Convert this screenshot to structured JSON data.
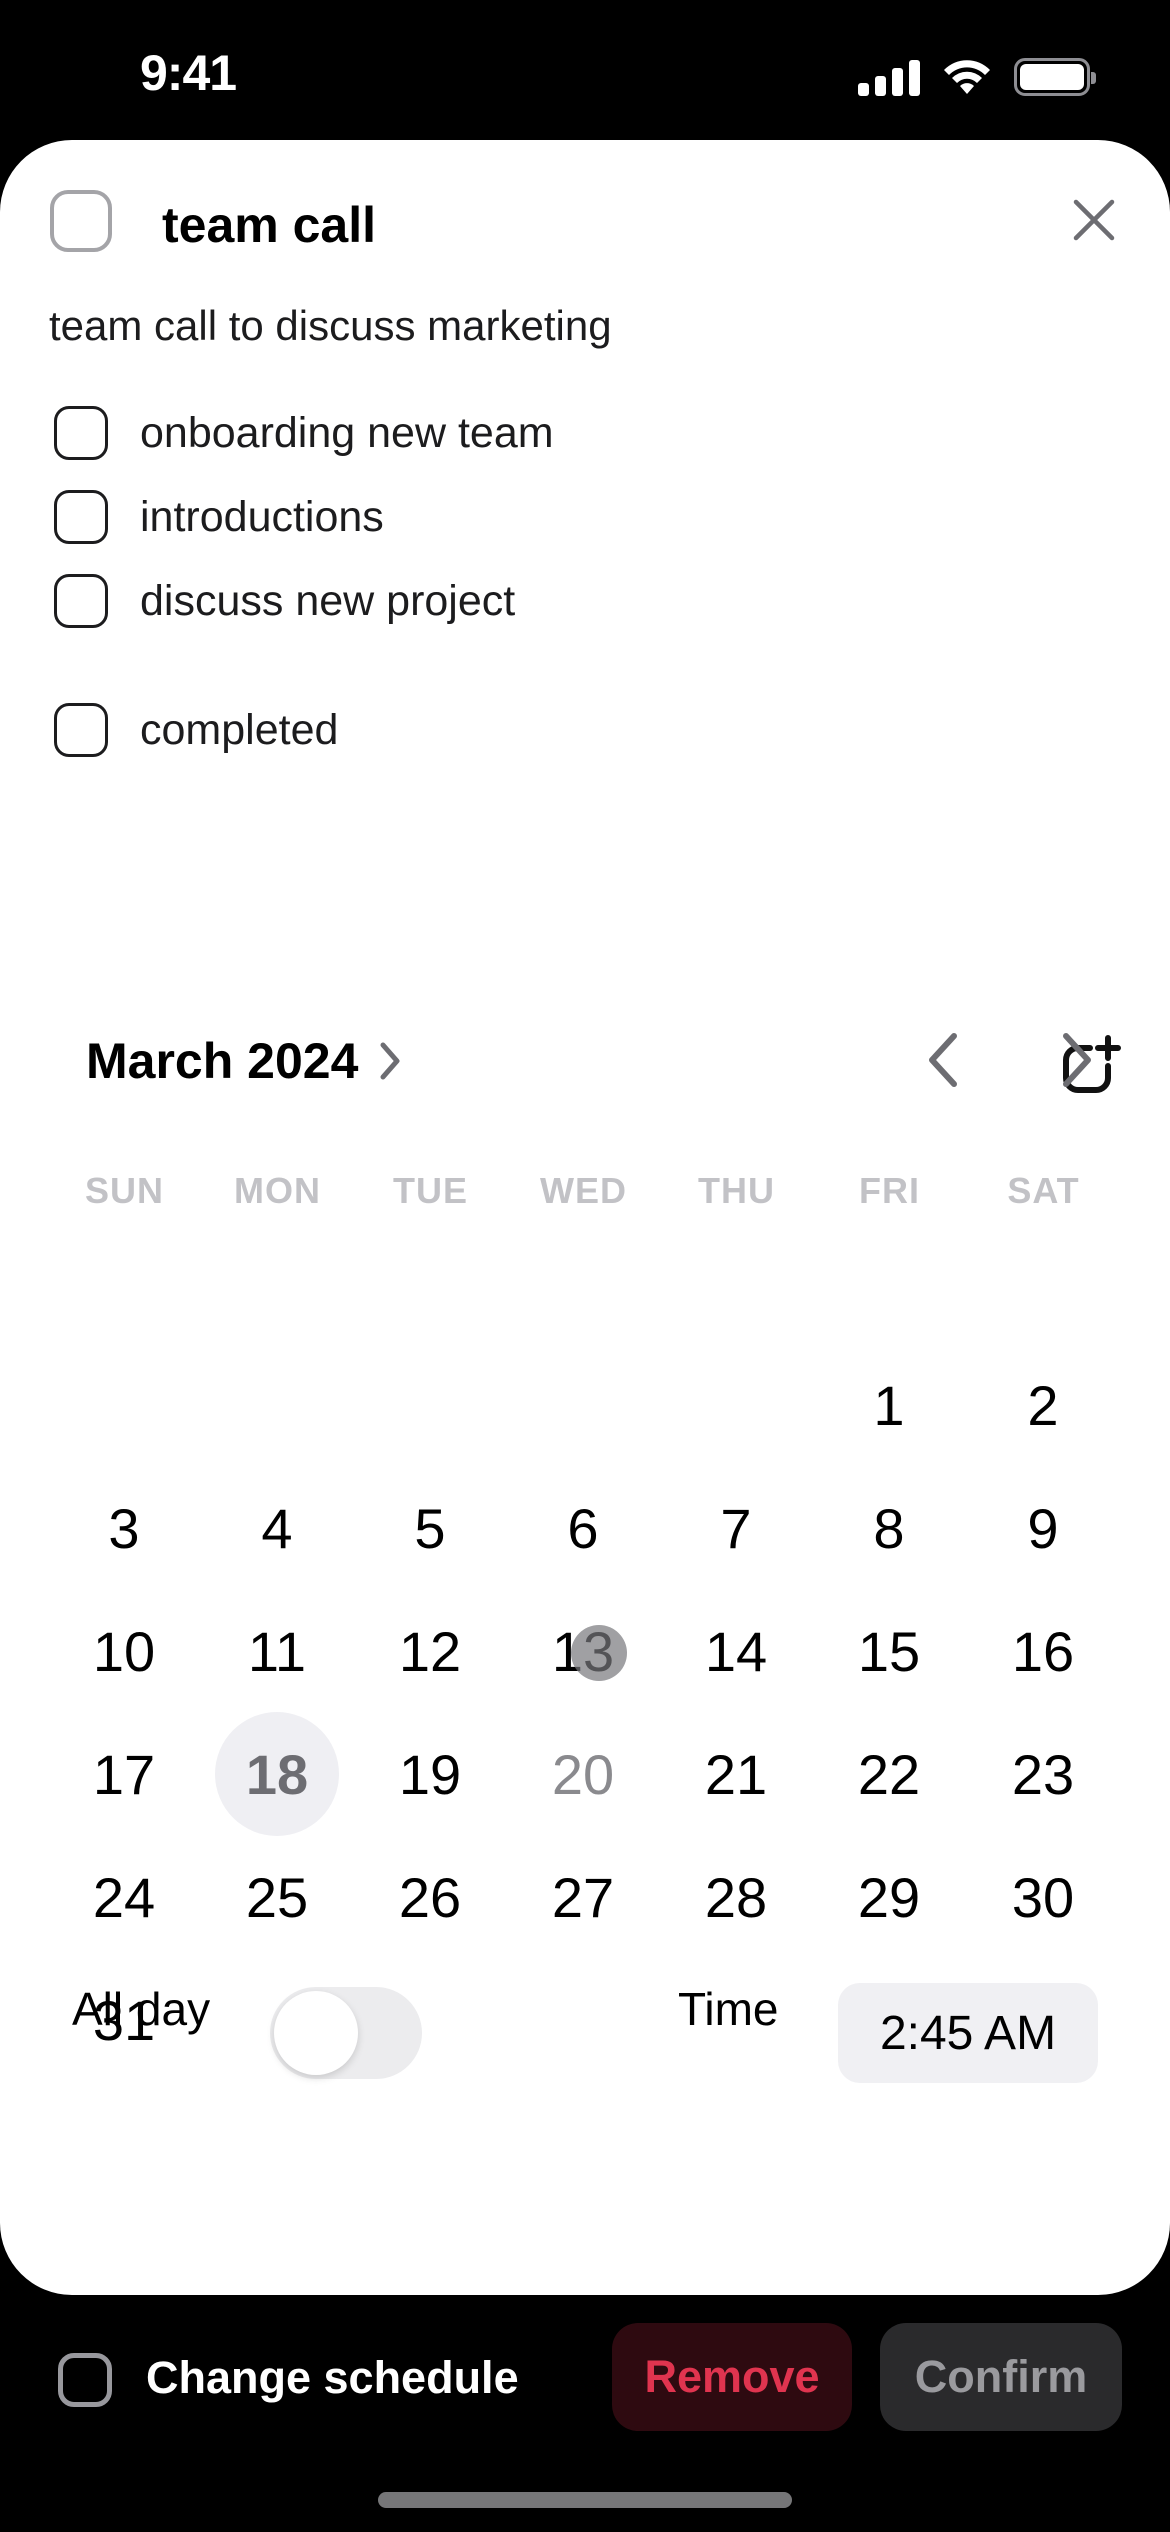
{
  "status_bar": {
    "time": "9:41",
    "icons": [
      "cellular-signal-icon",
      "wifi-icon",
      "battery-icon"
    ]
  },
  "task": {
    "title": "team call",
    "completed": false,
    "description": "team call to discuss marketing",
    "close_icon": "close-icon",
    "subtasks": [
      {
        "label": "onboarding new team",
        "checked": false
      },
      {
        "label": "introductions",
        "checked": false
      },
      {
        "label": "discuss new project",
        "checked": false
      }
    ],
    "completed_item": {
      "label": "completed",
      "checked": false
    },
    "add_subtask_icon": "add-item-icon"
  },
  "calendar": {
    "month_label": "March 2024",
    "month_chevron_icon": "chevron-right-icon",
    "prev_icon": "chevron-left-icon",
    "next_icon": "chevron-right-icon",
    "weekdays": [
      "SUN",
      "MON",
      "TUE",
      "WED",
      "THU",
      "FRI",
      "SAT"
    ],
    "first_weekday_index": 5,
    "days_in_month": 31,
    "selected_day": 18,
    "muted_days": [
      20
    ],
    "touch_indicator_day": 13,
    "accent_colors": {
      "selected_bg": "#efeff3",
      "selected_text": "#6d6d72"
    }
  },
  "schedule": {
    "all_day_label": "All day",
    "all_day_on": false,
    "time_label": "Time",
    "time_value": "2:45 AM"
  },
  "footer": {
    "change_schedule_label": "Change schedule",
    "change_schedule_checked": false,
    "remove_label": "Remove",
    "confirm_label": "Confirm",
    "colors": {
      "remove_text": "#e0344f",
      "remove_bg": "#2e0a10",
      "confirm_bg": "#2a2a2c"
    }
  }
}
